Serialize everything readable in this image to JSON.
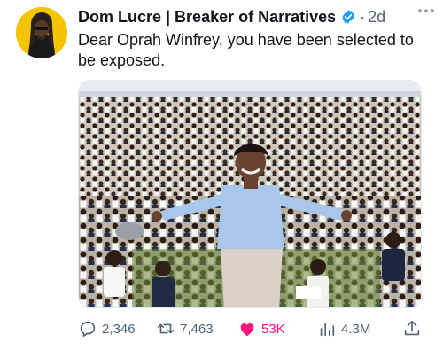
{
  "tweet": {
    "author": "Dom Lucre | Breaker of Narratives",
    "separator": "·",
    "time": "2d",
    "text": "Dear Oprah Winfrey, you have been selected to be exposed.",
    "media_alt": "Woman in a light blue shirt with arms outstretched standing in front of a large crowd of students in school uniforms",
    "metrics": {
      "replies": "2,346",
      "retweets": "7,463",
      "likes": "53K",
      "views": "4.3M"
    }
  },
  "colors": {
    "verified": "#1d9bf0",
    "like": "#f91880",
    "muted": "#536471",
    "avatar_bg": "#f5c400"
  }
}
